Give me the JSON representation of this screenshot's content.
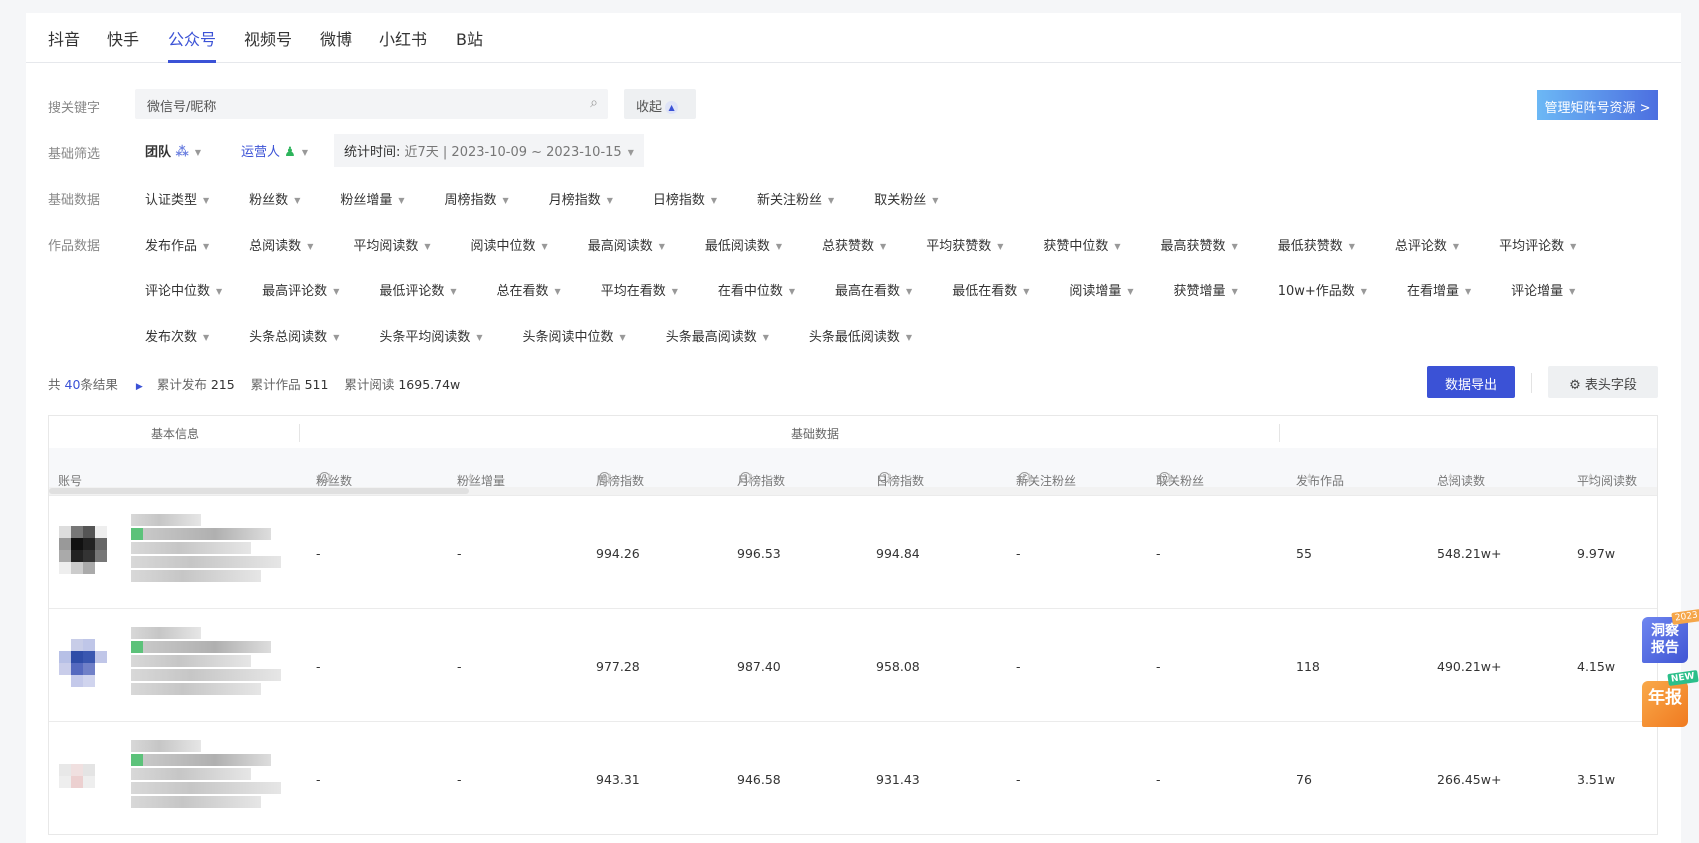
{
  "tabs": [
    "抖音",
    "快手",
    "公众号",
    "视频号",
    "微博",
    "小红书",
    "B站"
  ],
  "active_tab": "公众号",
  "search": {
    "label": "搜关键字",
    "placeholder": "微信号/昵称",
    "collapse": "收起"
  },
  "manage_button": "管理矩阵号资源 >",
  "basic_filter": {
    "label": "基础筛选",
    "team": "团队",
    "operator": "运营人",
    "time_label": "统计时间:",
    "time_value": "近7天 | 2023-10-09 ~ 2023-10-15"
  },
  "basic_data": {
    "label": "基础数据",
    "items": [
      "认证类型",
      "粉丝数",
      "粉丝增量",
      "周榜指数",
      "月榜指数",
      "日榜指数",
      "新关注粉丝",
      "取关粉丝"
    ]
  },
  "works_data": {
    "label": "作品数据",
    "rows": [
      [
        "发布作品",
        "总阅读数",
        "平均阅读数",
        "阅读中位数",
        "最高阅读数",
        "最低阅读数",
        "总获赞数",
        "平均获赞数",
        "获赞中位数",
        "最高获赞数",
        "最低获赞数",
        "总评论数",
        "平均评论数"
      ],
      [
        "评论中位数",
        "最高评论数",
        "最低评论数",
        "总在看数",
        "平均在看数",
        "在看中位数",
        "最高在看数",
        "最低在看数",
        "阅读增量",
        "获赞增量",
        "10w+作品数",
        "在看增量",
        "评论增量"
      ],
      [
        "发布次数",
        "头条总阅读数",
        "头条平均阅读数",
        "头条阅读中位数",
        "头条最高阅读数",
        "头条最低阅读数"
      ]
    ]
  },
  "summary": {
    "prefix": "共",
    "count": "40",
    "suffix": "条结果",
    "publish_label": "累计发布",
    "publish": "215",
    "works_label": "累计作品",
    "works": "511",
    "reads_label": "累计阅读",
    "reads": "1695.74w"
  },
  "export_button": "数据导出",
  "fields_button": "表头字段",
  "table": {
    "groups": [
      "基本信息",
      "基础数据"
    ],
    "columns": [
      "账号",
      "粉丝数",
      "粉丝增量",
      "周榜指数",
      "月榜指数",
      "日榜指数",
      "新关注粉丝",
      "取关粉丝",
      "发布作品",
      "总阅读数",
      "平均阅读数"
    ],
    "rows": [
      [
        "-",
        "-",
        "994.26",
        "996.53",
        "994.84",
        "-",
        "-",
        "55",
        "548.21w+",
        "9.97w"
      ],
      [
        "-",
        "-",
        "977.28",
        "987.40",
        "958.08",
        "-",
        "-",
        "118",
        "490.21w+",
        "4.15w"
      ],
      [
        "-",
        "-",
        "943.31",
        "946.58",
        "931.43",
        "-",
        "-",
        "76",
        "266.45w+",
        "3.51w"
      ]
    ]
  },
  "float": {
    "report": "洞察报告",
    "report_tag": "2023",
    "annual": "年报",
    "annual_tag": "NEW"
  },
  "colors": {
    "accent": "#3b52d6"
  }
}
